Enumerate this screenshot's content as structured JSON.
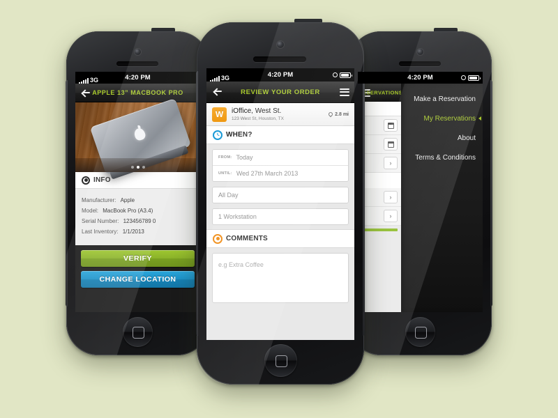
{
  "background_color": "#e1e6c5",
  "accent_green": "#a8c92c",
  "accent_blue": "#1b9ad6",
  "accent_orange": "#f08b12",
  "left_phone": {
    "status_bar": {
      "carrier": "3G",
      "time": "4:20 PM"
    },
    "nav": {
      "back_icon": "back-arrow-icon",
      "title": "APPLE 13” MACBOOK PRO"
    },
    "carousel": {
      "dots": 3,
      "active_index": 1
    },
    "info_section": {
      "icon": "info-icon",
      "title": "INFO",
      "rows": [
        {
          "label": "Manufacturer:",
          "value": "Apple"
        },
        {
          "label": "Model:",
          "value": "MacBook Pro (A3.4)"
        },
        {
          "label": "Serial Number:",
          "value": "123456789 0"
        },
        {
          "label": "Last Inventory:",
          "value": "1/1/2013"
        }
      ]
    },
    "buttons": [
      {
        "label": "VERIFY",
        "color": "#8cb42a"
      },
      {
        "label": "CHANGE LOCATION",
        "color": "#1d93c9"
      }
    ]
  },
  "center_phone": {
    "status_bar": {
      "carrier": "3G",
      "time": "4:20 PM"
    },
    "nav": {
      "back_icon": "back-arrow-icon",
      "title": "REVIEW YOUR ORDER",
      "menu_icon": "hamburger-menu-icon"
    },
    "venue": {
      "badge_letter": "W",
      "name": "iOffice, West St.",
      "address": "123 West St, Houston, TX",
      "distance": "2.8 mi",
      "distance_icon": "location-pin-icon"
    },
    "when_section": {
      "icon": "clock-icon",
      "title": "WHEN?",
      "fields": [
        {
          "label": "FROM:",
          "value": "Today"
        },
        {
          "label": "UNTIL:",
          "value": "Wed 27th March 2013"
        }
      ],
      "all_day": "All Day",
      "workstation": "1 Workstation"
    },
    "comments_section": {
      "icon": "comments-icon",
      "title": "COMMENTS",
      "placeholder": "e.g Extra Coffee"
    }
  },
  "right_phone": {
    "status_bar": {
      "time": "4:20 PM"
    },
    "under_nav": {
      "menu_icon": "hamburger-menu-icon",
      "title": "RESERVATIONS"
    },
    "drawer_menu": [
      {
        "label": "Make a Reservation",
        "active": false
      },
      {
        "label": "My Reservations",
        "active": true
      },
      {
        "label": "About",
        "active": false
      },
      {
        "label": "Terms & Conditions",
        "active": false
      }
    ]
  }
}
